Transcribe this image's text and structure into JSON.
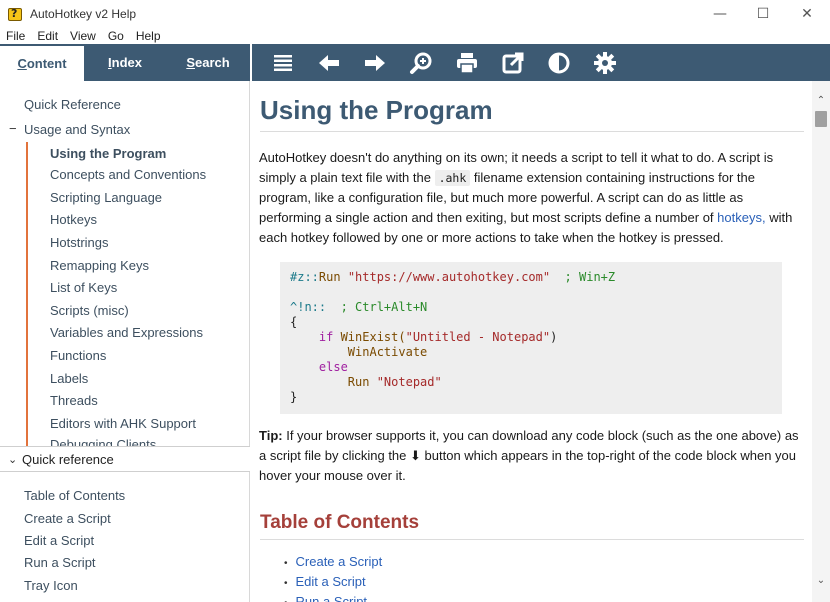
{
  "window": {
    "title": "AutoHotkey v2 Help",
    "minimize": "—",
    "maximize": "☐",
    "close": "✕"
  },
  "menu": [
    "File",
    "Edit",
    "View",
    "Go",
    "Help"
  ],
  "tabs": {
    "content_first": "C",
    "content_rest": "ontent",
    "index_first": "I",
    "index_rest": "ndex",
    "search_first": "S",
    "search_rest": "earch"
  },
  "toolbar": {
    "buttons": [
      "menu-icon",
      "back-arrow-icon",
      "forward-arrow-icon",
      "zoom-icon",
      "print-icon",
      "external-link-icon",
      "contrast-icon",
      "settings-gear-icon"
    ],
    "icon_color": "#ffffff",
    "bg_color": "#3d5a73"
  },
  "toc": {
    "quick_reference": "Quick Reference",
    "usage_toggle": "−",
    "usage_and_syntax": "Usage and Syntax",
    "children": [
      "Using the Program",
      "Concepts and Conventions",
      "Scripting Language",
      "Hotkeys",
      "Hotstrings",
      "Remapping Keys",
      "List of Keys",
      "Scripts (misc)",
      "Variables and Expressions",
      "Functions",
      "Labels",
      "Threads",
      "Editors with AHK Support",
      "Debugging Clients"
    ],
    "selected": "Using the Program",
    "accent_color": "#e2733c"
  },
  "quick_reference_panel": {
    "chevron": "⌄",
    "label": "Quick reference",
    "items": [
      "Table of Contents",
      "Create a Script",
      "Edit a Script",
      "Run a Script",
      "Tray Icon"
    ]
  },
  "content": {
    "title": "Using the Program",
    "intro_1": "AutoHotkey doesn't do anything on its own; it needs a script to tell it what to do. A script is simply a plain text file with the ",
    "intro_code": ".ahk",
    "intro_2": " filename extension containing instructions for the program, like a configuration file, but much more powerful. A script can do as little as performing a single action and then exiting, but most scripts define a number of ",
    "intro_link": "hotkeys,",
    "intro_3": " with each hotkey followed by one or more actions to take when the hotkey is pressed.",
    "code": {
      "l1_key": "#z::",
      "l1_cmd": "Run ",
      "l1_str": "\"https://www.autohotkey.com\"",
      "l1_cmt": "  ; Win+Z",
      "l2_key": "^!n::",
      "l2_cmt": "  ; Ctrl+Alt+N",
      "l3": "{",
      "l4_kw": "    if ",
      "l4_fn": "WinExist(",
      "l4_str": "\"Untitled - Notepad\"",
      "l4_end": ")",
      "l5_fn": "        WinActivate",
      "l6_kw": "    else",
      "l7_cmd": "        Run ",
      "l7_str": "\"Notepad\"",
      "l8": "}"
    },
    "tip_label": "Tip:",
    "tip_1": " If your browser supports it, you can download any code block (such as the one above) as a script file by clicking the ",
    "tip_icon": "⬇",
    "tip_2": " button which appears in the top-right of the code block when you hover your mouse over it.",
    "toc_heading": "Table of Contents",
    "toc_links": [
      "Create a Script",
      "Edit a Script",
      "Run a Script"
    ],
    "heading_color": "#3d5a73",
    "subheading_color": "#a5403a",
    "link_color": "#2a60b8"
  },
  "scrollbar": {
    "up": "⌃",
    "down": "⌄"
  }
}
